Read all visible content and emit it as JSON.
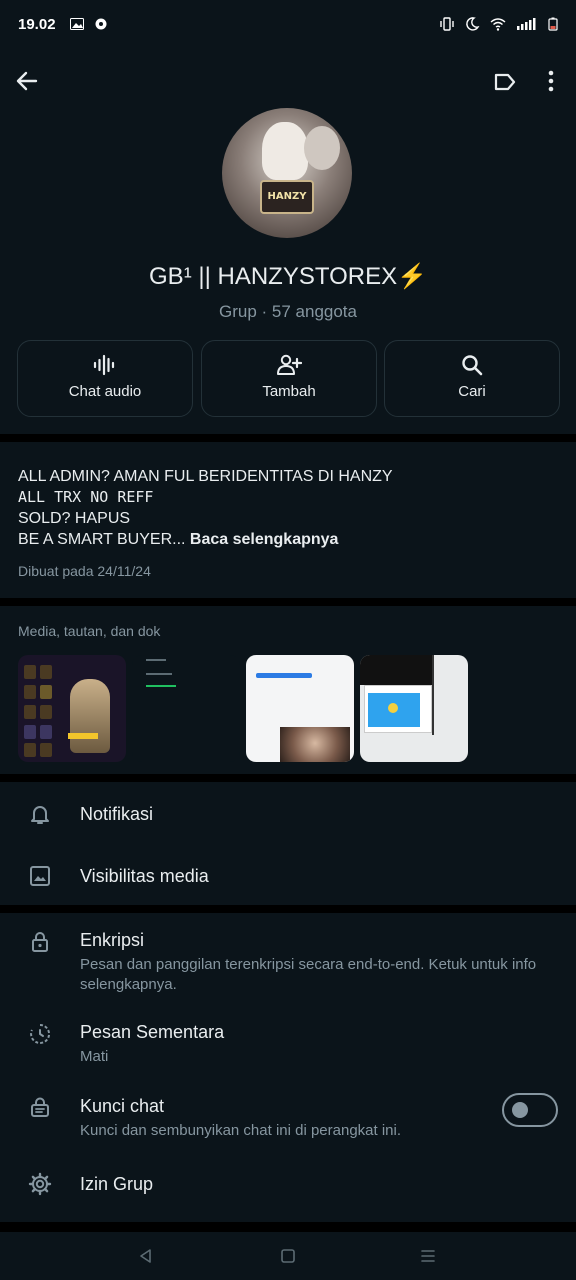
{
  "status_bar": {
    "time": "19.02"
  },
  "group": {
    "name": "GB¹ || HANZYSTOREX⚡",
    "meta": "Grup · 57 anggota"
  },
  "actions": [
    {
      "label": "Chat audio",
      "icon": "waveform-icon"
    },
    {
      "label": "Tambah",
      "icon": "add-person-icon"
    },
    {
      "label": "Cari",
      "icon": "search-icon"
    }
  ],
  "description": {
    "line1": "ALL ADMIN? AMAN FUL BERIDENTITAS DI HANZY",
    "line2": "ALL TRX NO REFF",
    "line3": "SOLD? HAPUS",
    "line4": "BE A SMART BUYER...",
    "read_more": "Baca selengkapnya",
    "created": "Dibuat pada 24/11/24"
  },
  "media": {
    "heading": "Media, tautan, dan dok"
  },
  "settings": {
    "notifications": {
      "title": "Notifikasi",
      "icon": "bell-icon"
    },
    "media_visibility": {
      "title": "Visibilitas media",
      "icon": "image-icon"
    },
    "encryption": {
      "title": "Enkripsi",
      "subtitle": "Pesan dan panggilan terenkripsi secara end-to-end. Ketuk untuk info selengkapnya.",
      "icon": "lock-icon"
    },
    "disappearing": {
      "title": "Pesan Sementara",
      "subtitle": "Mati",
      "icon": "timer-icon"
    },
    "chat_lock": {
      "title": "Kunci chat",
      "subtitle": "Kunci dan sembunyikan chat ini di perangkat ini.",
      "icon": "chat-lock-icon",
      "enabled": false
    },
    "group_permissions": {
      "title": "Izin Grup",
      "icon": "gear-icon"
    }
  },
  "colors": {
    "background": "#0b141a",
    "secondary_text": "#8696a0",
    "divider": "#000000"
  }
}
